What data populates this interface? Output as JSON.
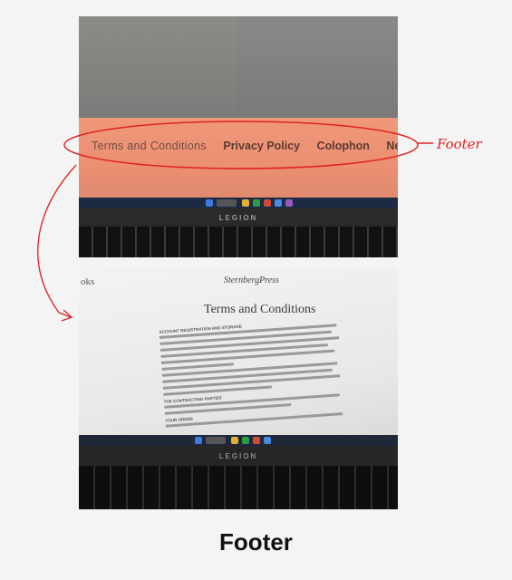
{
  "photo_top": {
    "footer_links": [
      "Terms and Conditions",
      "Privacy Policy",
      "Colophon",
      "Nev"
    ],
    "laptop_brand": "LEGION"
  },
  "photo_bottom": {
    "brand": "SternbergPress",
    "edge_text": "oks",
    "page_title": "Terms and Conditions",
    "section_headings": [
      "ACCOUNT REGISTRATION AND STORAGE",
      "THE CONTRACTING PARTIES",
      "YOUR ORDER"
    ],
    "laptop_brand": "LEGION"
  },
  "annotation": {
    "label": "Footer",
    "color": "#e02222"
  },
  "caption": "Footer"
}
